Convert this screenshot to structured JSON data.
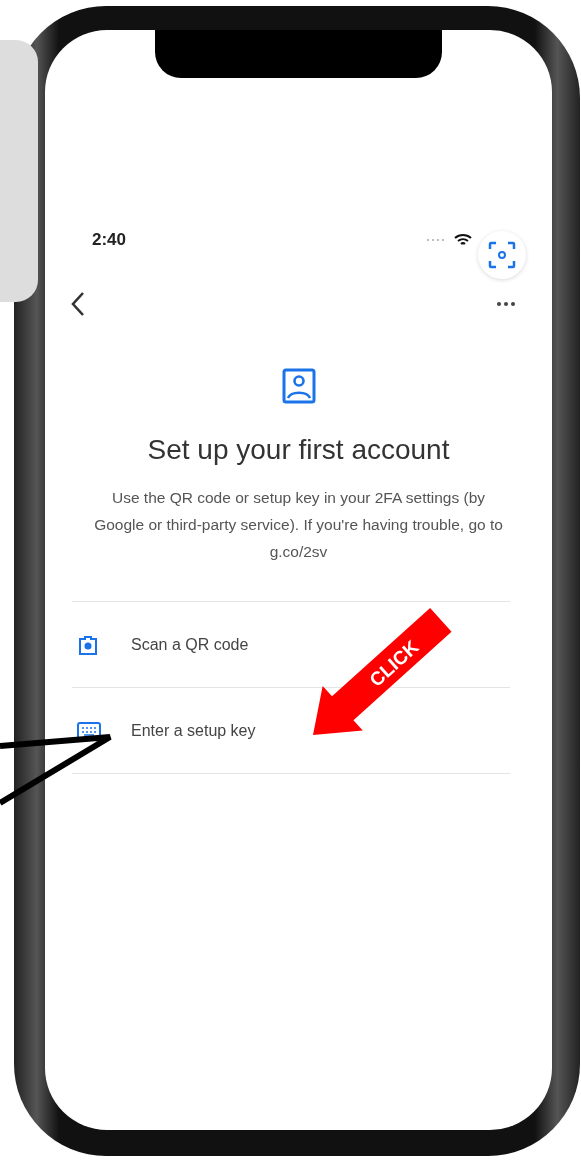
{
  "status_bar": {
    "time": "2:40"
  },
  "screen": {
    "title": "Set up your first account",
    "description": "Use the QR code or setup key in your 2FA settings (by Google or third-party service). If you're having trouble, go to g.co/2sv"
  },
  "options": [
    {
      "kind": "camera",
      "label": "Scan a QR code"
    },
    {
      "kind": "keyboard",
      "label": "Enter a setup key"
    }
  ],
  "annotation": {
    "label": "CLICK"
  }
}
